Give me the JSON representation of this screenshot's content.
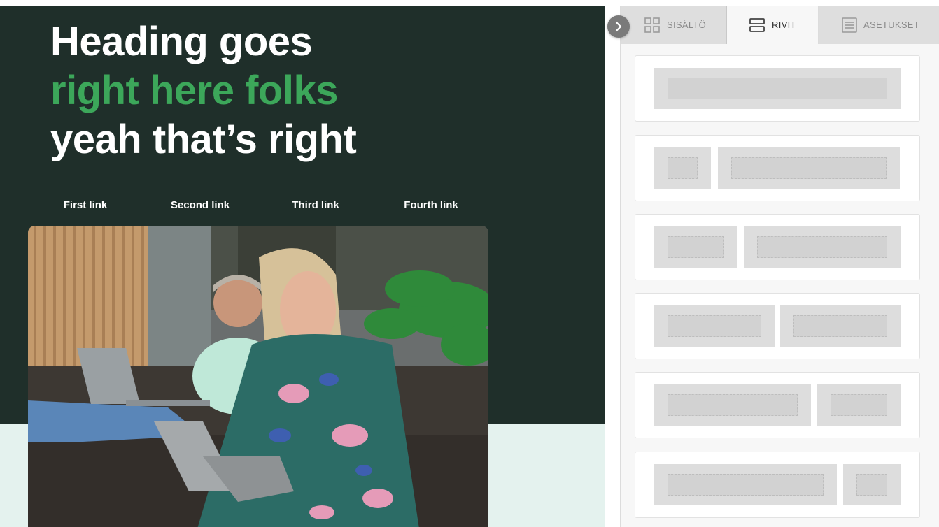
{
  "email": {
    "heading_line1": "Heading goes",
    "heading_line2": "right here folks",
    "heading_line3": "yeah that’s right",
    "links": [
      "First link",
      "Second link",
      "Third link",
      "Fourth link"
    ]
  },
  "panel": {
    "tabs": [
      {
        "label": "SISÄLTÖ",
        "icon": "grid-icon",
        "active": false
      },
      {
        "label": "RIVIT",
        "icon": "rows-icon",
        "active": true
      },
      {
        "label": "ASETUKSET",
        "icon": "settings-list-icon",
        "active": false
      }
    ],
    "row_layouts": [
      "1 column",
      "1:3 columns",
      "1:2 columns",
      "1:1 columns",
      "2:1 columns",
      "3:1 columns"
    ]
  },
  "colors": {
    "hero_background": "#1f2f2a",
    "accent_green": "#3ca75a",
    "canvas_background": "#e4f2ee",
    "panel_background": "#f7f7f7"
  }
}
